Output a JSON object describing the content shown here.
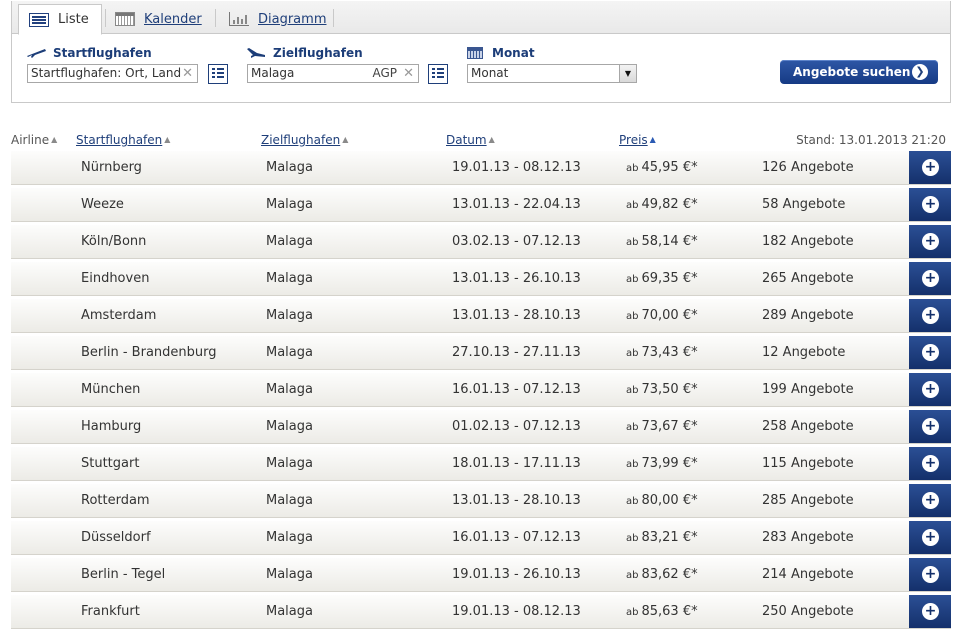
{
  "tabs": [
    {
      "label": "Liste",
      "icon": "list-icon",
      "active": true
    },
    {
      "label": "Kalender",
      "icon": "calendar-icon",
      "active": false
    },
    {
      "label": "Diagramm",
      "icon": "chart-icon",
      "active": false
    }
  ],
  "search": {
    "origin_label": "Startflughafen",
    "origin_placeholder": "Startflughafen: Ort, Land",
    "dest_label": "Zielflughafen",
    "dest_value": "Malaga",
    "dest_code": "AGP",
    "month_label": "Monat",
    "month_value": "Monat",
    "clear_glyph": "✕",
    "submit_label": "Angebote suchen",
    "submit_glyph": "❯"
  },
  "table": {
    "headers": {
      "airline": "Airline",
      "start": "Startflughafen",
      "ziel": "Zielflughafen",
      "datum": "Datum",
      "preis": "Preis"
    },
    "sort_glyph": "▲",
    "stand": "Stand: 13.01.2013 21:20",
    "price_prefix": "ab",
    "add_glyph": "+",
    "rows": [
      {
        "start": "Nürnberg",
        "ziel": "Malaga",
        "datum": "19.01.13 - 08.12.13",
        "preis": "45,95 €*",
        "angebote": "126 Angebote"
      },
      {
        "start": "Weeze",
        "ziel": "Malaga",
        "datum": "13.01.13 - 22.04.13",
        "preis": "49,82 €*",
        "angebote": "58 Angebote"
      },
      {
        "start": "Köln/Bonn",
        "ziel": "Malaga",
        "datum": "03.02.13 - 07.12.13",
        "preis": "58,14 €*",
        "angebote": "182 Angebote"
      },
      {
        "start": "Eindhoven",
        "ziel": "Malaga",
        "datum": "13.01.13 - 26.10.13",
        "preis": "69,35 €*",
        "angebote": "265 Angebote"
      },
      {
        "start": "Amsterdam",
        "ziel": "Malaga",
        "datum": "13.01.13 - 28.10.13",
        "preis": "70,00 €*",
        "angebote": "289 Angebote"
      },
      {
        "start": "Berlin - Brandenburg",
        "ziel": "Malaga",
        "datum": "27.10.13 - 27.11.13",
        "preis": "73,43 €*",
        "angebote": "12 Angebote"
      },
      {
        "start": "München",
        "ziel": "Malaga",
        "datum": "16.01.13 - 07.12.13",
        "preis": "73,50 €*",
        "angebote": "199 Angebote"
      },
      {
        "start": "Hamburg",
        "ziel": "Malaga",
        "datum": "01.02.13 - 07.12.13",
        "preis": "73,67 €*",
        "angebote": "258 Angebote"
      },
      {
        "start": "Stuttgart",
        "ziel": "Malaga",
        "datum": "18.01.13 - 17.11.13",
        "preis": "73,99 €*",
        "angebote": "115 Angebote"
      },
      {
        "start": "Rotterdam",
        "ziel": "Malaga",
        "datum": "13.01.13 - 28.10.13",
        "preis": "80,00 €*",
        "angebote": "285 Angebote"
      },
      {
        "start": "Düsseldorf",
        "ziel": "Malaga",
        "datum": "16.01.13 - 07.12.13",
        "preis": "83,21 €*",
        "angebote": "283 Angebote"
      },
      {
        "start": "Berlin - Tegel",
        "ziel": "Malaga",
        "datum": "19.01.13 - 26.10.13",
        "preis": "83,62 €*",
        "angebote": "214 Angebote"
      },
      {
        "start": "Frankfurt",
        "ziel": "Malaga",
        "datum": "19.01.13 - 08.12.13",
        "preis": "85,63 €*",
        "angebote": "250 Angebote"
      }
    ]
  }
}
